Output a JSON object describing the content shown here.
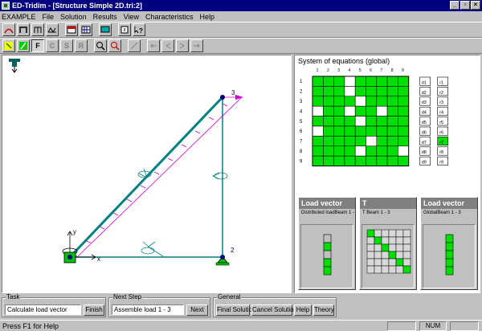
{
  "window": {
    "title": "ED-Tridim - [Structure Simple 2D.tri:2]"
  },
  "window_buttons": {
    "minimize": "_",
    "restore": "▫",
    "close": "×"
  },
  "menu": [
    "EXAMPLE",
    "File",
    "Solution",
    "Results",
    "View",
    "Characteristics",
    "Help"
  ],
  "toolbar2": {
    "f": "F",
    "c": "C",
    "s": "S",
    "r": "R"
  },
  "structure": {
    "node_labels": [
      "2",
      "3"
    ],
    "axis_x": "x",
    "axis_y": "y"
  },
  "system": {
    "title": "System of equations (global)",
    "col_headers": [
      "1",
      "2",
      "3",
      "4",
      "5",
      "6",
      "7",
      "8",
      "9"
    ],
    "row_headers": [
      "1",
      "2",
      "3",
      "4",
      "5",
      "6",
      "7",
      "8",
      "9"
    ],
    "matrix": [
      [
        1,
        1,
        1,
        0,
        1,
        1,
        1,
        1,
        1
      ],
      [
        1,
        1,
        1,
        0,
        1,
        1,
        1,
        1,
        1
      ],
      [
        1,
        1,
        1,
        1,
        0,
        1,
        1,
        1,
        1
      ],
      [
        0,
        1,
        1,
        0,
        1,
        1,
        0,
        1,
        1
      ],
      [
        1,
        1,
        1,
        1,
        0,
        1,
        1,
        1,
        1
      ],
      [
        0,
        1,
        1,
        1,
        1,
        1,
        1,
        1,
        1
      ],
      [
        1,
        1,
        1,
        1,
        1,
        0,
        1,
        1,
        1
      ],
      [
        1,
        1,
        1,
        1,
        0,
        1,
        1,
        1,
        0
      ],
      [
        1,
        1,
        1,
        1,
        1,
        1,
        1,
        1,
        1
      ]
    ],
    "d_vector": [
      "d1",
      "d2",
      "d3",
      "d4",
      "d5",
      "d6",
      "d7",
      "d8",
      "d9"
    ],
    "r_vector": [
      "r1",
      "r2",
      "r3",
      "r4",
      "r5",
      "r6",
      "r7",
      "r8",
      "r9"
    ],
    "r_highlight_index": 6,
    "colors": {
      "filled": "#00e000",
      "empty": "#ffffff",
      "grid": "#000000"
    }
  },
  "panels": [
    {
      "title": "Load vector",
      "subtitle": "Distributed loadBeam 1 - 3",
      "kind": "vector",
      "cells": [
        0,
        1,
        0,
        1,
        1
      ]
    },
    {
      "title": "T",
      "subtitle": "T Beam 1 - 3",
      "kind": "matrix"
    },
    {
      "title": "Load vector",
      "subtitle": "GlobalBeam 1 - 3",
      "kind": "vector",
      "cells": [
        1,
        1,
        1,
        1,
        1
      ]
    }
  ],
  "t_matrix": [
    [
      1,
      0,
      0,
      0,
      0,
      0
    ],
    [
      0,
      1,
      0,
      0,
      0,
      0
    ],
    [
      0,
      0,
      1,
      0,
      0,
      0
    ],
    [
      0,
      0,
      0,
      1,
      0,
      0
    ],
    [
      0,
      0,
      0,
      0,
      1,
      0
    ],
    [
      0,
      0,
      0,
      0,
      0,
      1
    ]
  ],
  "bottom": {
    "task": {
      "label": "Task",
      "value": "Calculate load vector",
      "button": "Finish"
    },
    "next_step": {
      "label": "Next Step",
      "value": "Assemble load 1 - 3",
      "button": "Next"
    },
    "general": {
      "label": "General",
      "buttons": [
        "Final Solution",
        "Cancel Solution",
        "Help",
        "Theory"
      ]
    }
  },
  "status": {
    "text": "Press F1 for Help",
    "num": "NUM"
  }
}
